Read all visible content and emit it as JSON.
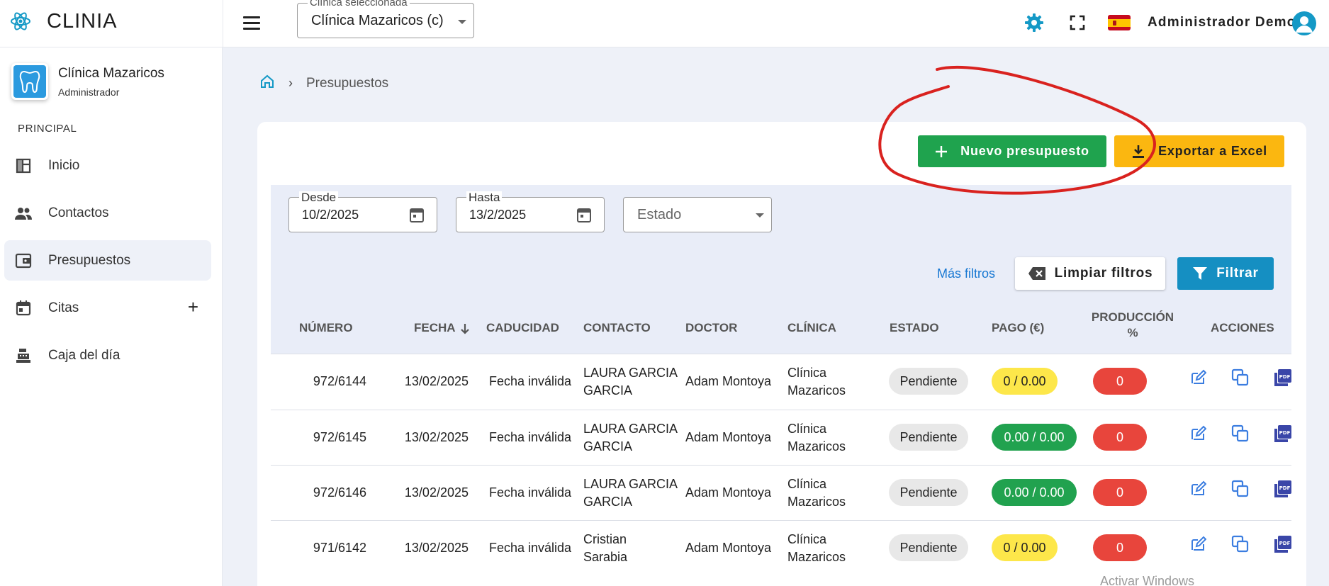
{
  "app": {
    "name": "CLINIA"
  },
  "topbar": {
    "clinic_select_legend": "Clínica seleccionada",
    "clinic_select_value": "Clínica Mazaricos (c)",
    "user_name": "Administrador Demo",
    "language_flag": "es",
    "icons": [
      "menu-icon",
      "gear-icon",
      "fullscreen-icon",
      "spain-flag-icon",
      "user-avatar-icon"
    ]
  },
  "sidebar": {
    "clinic_name": "Clínica Mazaricos",
    "clinic_role": "Administrador",
    "section_title": "PRINCIPAL",
    "items": [
      {
        "label": "Inicio",
        "icon": "dashboard-icon",
        "active": false
      },
      {
        "label": "Contactos",
        "icon": "people-icon",
        "active": false
      },
      {
        "label": "Presupuestos",
        "icon": "wallet-icon",
        "active": true
      },
      {
        "label": "Citas",
        "icon": "calendar-icon",
        "active": false,
        "extra": "+"
      },
      {
        "label": "Caja del día",
        "icon": "cash-register-icon",
        "active": false
      }
    ]
  },
  "breadcrumb": {
    "separator": "›",
    "current": "Presupuestos"
  },
  "actions": {
    "new_label": "Nuevo presupuesto",
    "export_label": "Exportar a Excel"
  },
  "filters": {
    "desde_label": "Desde",
    "desde_value": "10/2/2025",
    "hasta_label": "Hasta",
    "hasta_value": "13/2/2025",
    "estado_placeholder": "Estado",
    "more_filters": "Más filtros",
    "clear_label": "Limpiar filtros",
    "filter_label": "Filtrar"
  },
  "table": {
    "columns": [
      "NÚMERO",
      "FECHA",
      "CADUCIDAD",
      "CONTACTO",
      "DOCTOR",
      "CLÍNICA",
      "ESTADO",
      "PAGO (€)",
      "PRODUCCIÓN %",
      "ACCIONES"
    ],
    "sorted_column": "FECHA",
    "rows": [
      {
        "numero": "972/6144",
        "fecha": "13/02/2025",
        "caducidad": "Fecha inválida",
        "contacto_1": "LAURA GARCIA",
        "contacto_2": "GARCIA",
        "doctor": "Adam Montoya",
        "clinica_1": "Clínica",
        "clinica_2": "Mazaricos",
        "estado": "Pendiente",
        "pago": "0 / 0.00",
        "pago_status": "yellow",
        "produccion": "0"
      },
      {
        "numero": "972/6145",
        "fecha": "13/02/2025",
        "caducidad": "Fecha inválida",
        "contacto_1": "LAURA GARCIA",
        "contacto_2": "GARCIA",
        "doctor": "Adam Montoya",
        "clinica_1": "Clínica",
        "clinica_2": "Mazaricos",
        "estado": "Pendiente",
        "pago": "0.00 / 0.00",
        "pago_status": "green",
        "produccion": "0"
      },
      {
        "numero": "972/6146",
        "fecha": "13/02/2025",
        "caducidad": "Fecha inválida",
        "contacto_1": "LAURA GARCIA",
        "contacto_2": "GARCIA",
        "doctor": "Adam Montoya",
        "clinica_1": "Clínica",
        "clinica_2": "Mazaricos",
        "estado": "Pendiente",
        "pago": "0.00 / 0.00",
        "pago_status": "green",
        "produccion": "0"
      },
      {
        "numero": "971/6142",
        "fecha": "13/02/2025",
        "caducidad": "Fecha inválida",
        "contacto_1": "Cristian",
        "contacto_2": "Sarabia",
        "doctor": "Adam Montoya",
        "clinica_1": "Clínica",
        "clinica_2": "Mazaricos",
        "estado": "Pendiente",
        "pago": "0 / 0.00",
        "pago_status": "yellow",
        "produccion": "0"
      }
    ]
  },
  "watermark": "Activar Windows",
  "colors": {
    "green": "#1fa34e",
    "yellow": "#fbb710",
    "blue": "#158fc2",
    "red": "#e8453c",
    "annotation": "#d9221f"
  }
}
